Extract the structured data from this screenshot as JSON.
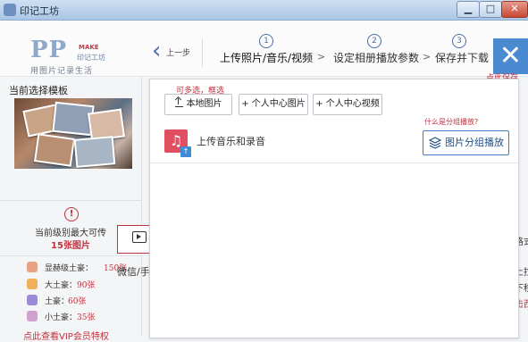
{
  "window": {
    "title": "印记工坊",
    "controls": {
      "minimize": "▁",
      "maximize": "□",
      "close": "✕"
    }
  },
  "header": {
    "logo": {
      "pp": "PP",
      "make": "MAKE",
      "brand": "印记工坊",
      "tagline": "用图片记录生活"
    },
    "back_label": "上一步",
    "steps": [
      {
        "num": "1",
        "label": "上传照片/音乐/视频",
        "active": true
      },
      {
        "num": "2",
        "label": "设定相册播放参数",
        "active": false
      },
      {
        "num": "3",
        "label": "保存并下载",
        "active": false
      }
    ],
    "step_arrow": ">",
    "exit_icon": "✕",
    "exit_hint": "点此保存"
  },
  "left_panel": {
    "title": "当前选择模板",
    "warn_icon": "!",
    "limit_line1": "当前级别最大可传",
    "limit_line2": "15张图片",
    "tiers": [
      {
        "name": "显赫级土豪：",
        "count": "150张",
        "color": "#e8a080"
      },
      {
        "name": "大土豪：",
        "count": "90张",
        "color": "#f0b05a"
      },
      {
        "name": "土豪：",
        "count": "60张",
        "color": "#9a8ad8"
      },
      {
        "name": "小土豪：",
        "count": "35张",
        "color": "#d0a0d0"
      }
    ],
    "vip_link": "点此查看VIP会员特权"
  },
  "background": {
    "wechat_text": "微信/手机",
    "right_fragments": [
      "格式",
      "上拉",
      "下移",
      "击西"
    ]
  },
  "dialog": {
    "multi_hint": "可多选，框选",
    "buttons": {
      "local": "本地图片",
      "center_photo": "+ 个人中心图片",
      "center_video": "+ 个人中心视频"
    },
    "group_hint": "什么是分组播放?",
    "music_icon": "♫",
    "music_badge": "↑",
    "music_label": "上传音乐和录音",
    "group_button": "图片分组播放"
  }
}
